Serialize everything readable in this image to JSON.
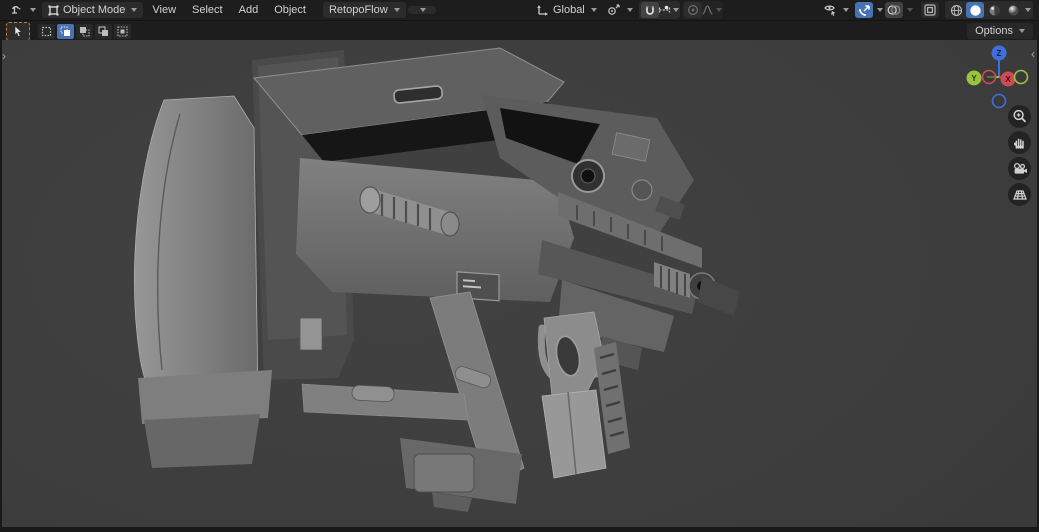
{
  "header": {
    "editor_type": {
      "icon": "editor-type-3d-viewport-icon"
    },
    "mode_selector": {
      "icon": "object-mode-icon",
      "label": "Object Mode"
    },
    "menus": [
      {
        "label": "View"
      },
      {
        "label": "Select"
      },
      {
        "label": "Add"
      },
      {
        "label": "Object"
      }
    ],
    "retopoflow": {
      "label": "RetopoFlow"
    },
    "transform_orientation": {
      "icon": "orientation-axes-icon",
      "label": "Global"
    },
    "pivot_point": {
      "icon": "pivot-point-icon"
    },
    "snapping": {
      "magnet_icon": "magnet-icon",
      "snap_with_icon": "snap-increment-icon",
      "enabled": true
    },
    "proportional_editing": {
      "icon": "proportional-circle-icon",
      "falloff_icon": "smooth-falloff-icon",
      "enabled": false
    },
    "object_type_visibility": {
      "icon": "visibility-dropdown-icon"
    },
    "show_gizmo": {
      "icon": "gizmo-arrow-arc-icon",
      "active": true
    },
    "show_overlays": {
      "icon": "overlays-spheres-icon",
      "active": false
    },
    "toggle_xray": {
      "icon": "xray-squares-icon",
      "active": false
    },
    "shading_modes": {
      "items": [
        "wireframe",
        "solid",
        "material-preview",
        "rendered"
      ],
      "active": "solid"
    }
  },
  "tool_settings": {
    "active_tool": {
      "icon": "select-box-cursor-icon"
    },
    "select_mode_buttons": {
      "icons": [
        "select-set-icon",
        "select-extend-icon",
        "select-subtract-icon",
        "select-invert-icon",
        "select-intersect-icon"
      ],
      "active_index": 1
    },
    "options": {
      "label": "Options"
    }
  },
  "viewport": {
    "model_description": "gray sci-fi bullpup rifle 3D model",
    "nav_gizmo": {
      "x_label": "X",
      "y_label": "Y",
      "z_label": "Z"
    },
    "side_buttons": [
      "zoom-icon",
      "pan-hand-icon",
      "camera-view-icon",
      "perspective-grid-icon"
    ],
    "collapse_arrows": {
      "left": "›",
      "right": "‹"
    }
  },
  "colors": {
    "accent_blue": "#4772b3",
    "header_bg": "#1d1d1d",
    "viewport_bg": "#3d3d3d",
    "axis_x_red": "#cf4a56",
    "axis_y_green": "#9bc23d",
    "axis_z_blue": "#3f6fdd",
    "tool_outline_orange": "#c87d2e"
  }
}
